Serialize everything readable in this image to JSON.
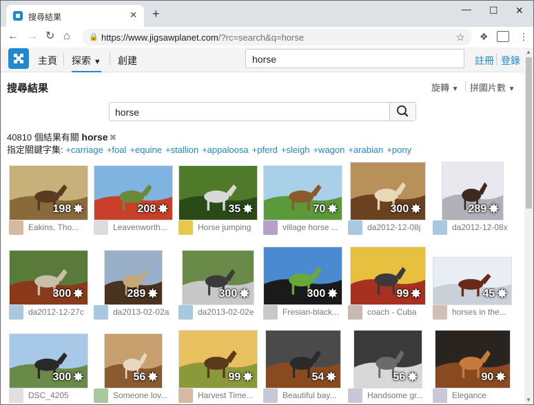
{
  "browser": {
    "tab_title": "搜尋結果",
    "tab_close": "✕",
    "new_tab": "+",
    "url_host": "https://www.jigsawplanet.com",
    "url_path": "/?rc=search&q=horse",
    "win_min": "—",
    "win_max": "☐",
    "win_close": "✕"
  },
  "site": {
    "nav": [
      "主頁",
      "探索",
      "創建"
    ],
    "search_value": "horse",
    "register": "註冊",
    "login": "登錄"
  },
  "page": {
    "title": "搜尋結果",
    "sort_rotate": "旋轉",
    "sort_pieces": "拼圖片數",
    "search_value": "horse",
    "result_count": "40810",
    "result_text": " 個結果有關 ",
    "query": "horse",
    "keywords_label": "指定關鍵字集:",
    "keywords": [
      "+carriage",
      "+foal",
      "+equine",
      "+stallion",
      "+appaloosa",
      "+pferd",
      "+sleigh",
      "+wagon",
      "+arabian",
      "+pony"
    ]
  },
  "results": [
    {
      "pieces": "198",
      "caption": "Eakins, Tho...",
      "colors": [
        "#c8b07a",
        "#8a6a3a",
        "#5a3a20"
      ],
      "avatar": "#d7b9a0"
    },
    {
      "pieces": "208",
      "caption": "Leavenworth...",
      "colors": [
        "#7fb4e0",
        "#c8402a",
        "#6a8a3a"
      ],
      "avatar": "#dcdcdc"
    },
    {
      "pieces": "35",
      "caption": "Horse jumping",
      "colors": [
        "#4f7a2a",
        "#2a4a18",
        "#d8d8d8"
      ],
      "avatar": "#e8c84a"
    },
    {
      "pieces": "70",
      "caption": "village horse ...",
      "colors": [
        "#a8d0e8",
        "#5a9a3a",
        "#8a5a2a"
      ],
      "avatar": "#b8a0c8"
    },
    {
      "pieces": "300",
      "caption": "da2012-12-08j",
      "colors": [
        "#b8905a",
        "#6a4220",
        "#e8d8b8"
      ],
      "avatar": "#a8c8e0"
    },
    {
      "pieces": "289",
      "caption": "da2012-12-08x",
      "colors": [
        "#e8e8ee",
        "#b0b0b8",
        "#3a2a20"
      ],
      "avatar": "#a8c8e0"
    },
    {
      "pieces": "300",
      "caption": "da2012-12-27c",
      "colors": [
        "#5a7a3a",
        "#8a3a1a",
        "#c8c0a8"
      ],
      "avatar": "#a8c8e0"
    },
    {
      "pieces": "289",
      "caption": "da2013-02-02a",
      "colors": [
        "#9ab0c8",
        "#4a3220",
        "#c8a878"
      ],
      "avatar": "#a8c8e0"
    },
    {
      "pieces": "300",
      "caption": "da2013-02-02e",
      "colors": [
        "#6a8a4a",
        "#c8c8c8",
        "#3a3a3a"
      ],
      "avatar": "#a8c8e0"
    },
    {
      "pieces": "300",
      "caption": "Fresian-black...",
      "colors": [
        "#4a8ad0",
        "#1a1a1a",
        "#6aa83a"
      ],
      "avatar": "#c8c8c8"
    },
    {
      "pieces": "99",
      "caption": "coach - Cuba",
      "colors": [
        "#e8c040",
        "#a83020",
        "#3a3a3a"
      ],
      "avatar": "#c8b8b0"
    },
    {
      "pieces": "45",
      "caption": "horses in the...",
      "colors": [
        "#e8eef4",
        "#c8d0d8",
        "#6a2a1a"
      ],
      "avatar": "#d0c0b8"
    },
    {
      "pieces": "300",
      "caption": "DSC_4205",
      "colors": [
        "#a8c8e8",
        "#6a8a4a",
        "#2a2a2a"
      ],
      "avatar": "#e0e0e0"
    },
    {
      "pieces": "56",
      "caption": "Someone lov...",
      "colors": [
        "#c8a070",
        "#8a5a30",
        "#e8d8c0"
      ],
      "avatar": "#a8c8a0"
    },
    {
      "pieces": "99",
      "caption": "Harvest Time...",
      "colors": [
        "#e8c060",
        "#8a9a3a",
        "#5a3a1a"
      ],
      "avatar": "#d8b8a0"
    },
    {
      "pieces": "54",
      "caption": "Beautiful bay...",
      "colors": [
        "#4a4a4a",
        "#8a4a20",
        "#2a2a2a"
      ],
      "avatar": "#c8c8d8"
    },
    {
      "pieces": "56",
      "caption": "Handsome gr...",
      "colors": [
        "#3a3a3a",
        "#d8d8d8",
        "#6a6a6a"
      ],
      "avatar": "#c8c8d8"
    },
    {
      "pieces": "90",
      "caption": "Elegance",
      "colors": [
        "#2a2420",
        "#8a4a20",
        "#c87a3a"
      ],
      "avatar": "#c8c8d8"
    }
  ]
}
